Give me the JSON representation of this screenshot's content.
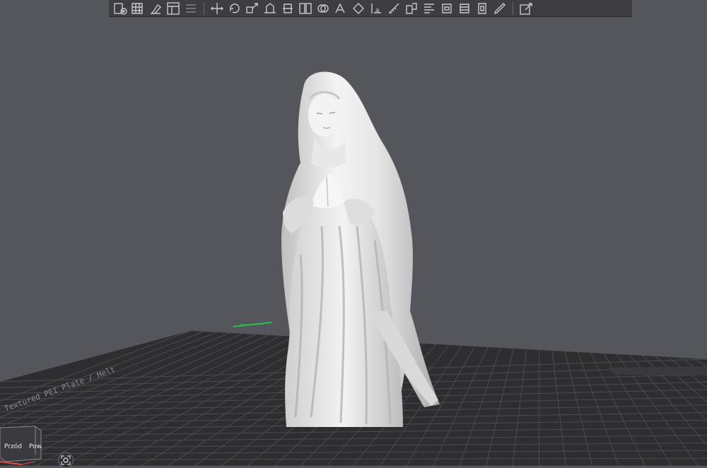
{
  "app": {
    "name": "3D slicer viewport"
  },
  "toolbar": {
    "groups": [
      [
        "add-object-icon",
        "arrange-grid-icon",
        "orient-icon",
        "layout-icon",
        "list-icon"
      ],
      [
        "move-icon",
        "rotate-icon",
        "scale-icon",
        "place-face-icon",
        "cut-icon",
        "split-icon",
        "mesh-boolean-icon",
        "support-paint-icon",
        "seam-paint-icon",
        "text-icon",
        "measure-icon",
        "assembly-icon",
        "variable-layer-icon",
        "brim-ears-icon",
        "layers-icon",
        "slice-icon",
        "pen-icon"
      ],
      [
        "edit-view-icon"
      ]
    ]
  },
  "bed": {
    "label": "Textured PEI Plate / Helt",
    "color": "#2e2e31",
    "grid_color": "#4b4b50"
  },
  "model": {
    "name": "praying-figure-statue",
    "color": "#e9e9e9"
  },
  "view_cube": {
    "front_label": "Przód",
    "right_label": "Pow"
  },
  "colors": {
    "background": "#55555c",
    "toolbar": "#3d3d42",
    "icon": "#c8c8cc",
    "axis_green": "#23c24a",
    "axis_red": "#e44d4d"
  }
}
